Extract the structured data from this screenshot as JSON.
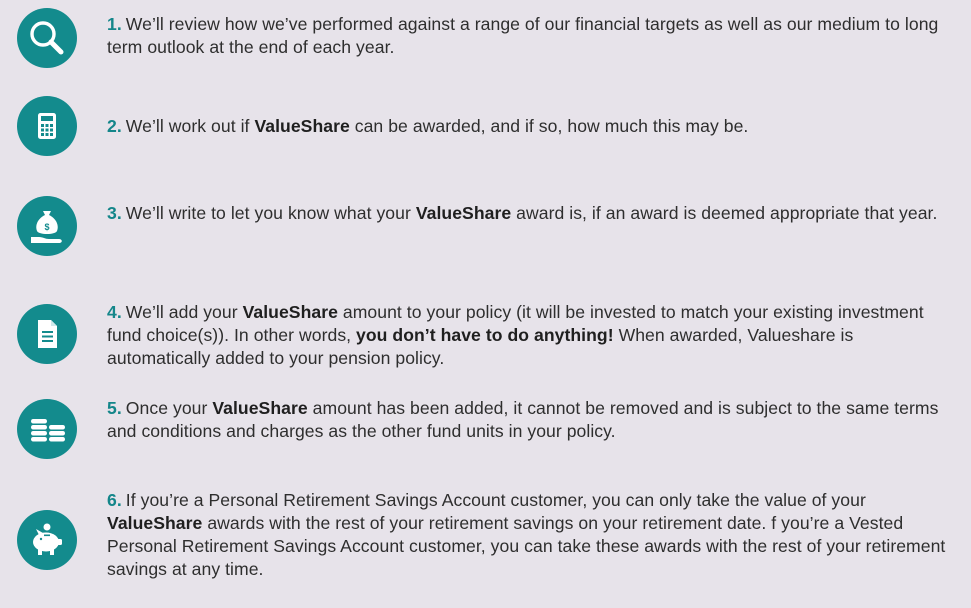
{
  "colors": {
    "background": "#e7e3ea",
    "icon_circle": "#138b8d",
    "step_number": "#14868a",
    "text": "#2e2e2e"
  },
  "steps": [
    {
      "icon": "magnifying-glass-icon",
      "number": "1.",
      "text": "We’ll review how we’ve performed against a range of our financial targets as well as our medium to long term outlook at the end of each year."
    },
    {
      "icon": "calculator-icon",
      "number": "2.",
      "pre": "We’ll work out if ",
      "bold": "ValueShare",
      "post": " can be awarded, and if so, how much this may be."
    },
    {
      "icon": "money-bag-hand-icon",
      "number": "3.",
      "pre": "We’ll write to let you know what your ",
      "bold": "ValueShare",
      "post": " award is, if an award is deemed appropriate that year."
    },
    {
      "icon": "document-icon",
      "number": "4.",
      "pre": "We’ll add your ",
      "bold": "ValueShare",
      "mid": " amount to your policy (it will be invested to match your existing investment fund choice(s)). In other words, ",
      "bold2": "you don’t have to do anything!",
      "post": " When awarded, Valueshare is automatically added to your pension policy."
    },
    {
      "icon": "coin-stacks-icon",
      "number": "5.",
      "pre": "Once your ",
      "bold": "ValueShare",
      "post": " amount has been added, it cannot be removed and is subject to the same terms and conditions and charges as the other fund units in your policy."
    },
    {
      "icon": "piggy-bank-icon",
      "number": "6.",
      "pre": "If you’re a Personal Retirement Savings Account customer, you can only take the value of your ",
      "bold": "ValueShare",
      "post": " awards with the rest of your retirement savings on your retirement date. f you’re a Vested Personal Retirement Savings Account customer, you can take these awards with the rest of your retirement savings at any time."
    }
  ]
}
